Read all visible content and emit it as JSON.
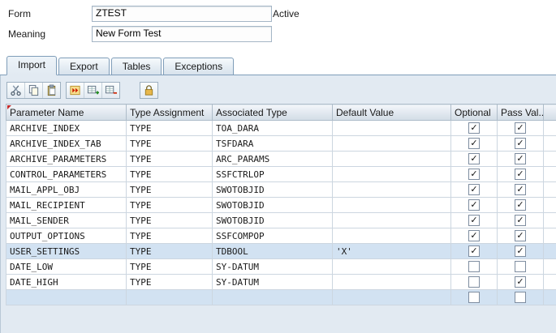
{
  "form_header": {
    "form_label": "Form",
    "form_value": "ZTEST",
    "status": "Active",
    "meaning_label": "Meaning",
    "meaning_value": "New Form Test"
  },
  "tabs": [
    {
      "label": "Import",
      "active": true
    },
    {
      "label": "Export",
      "active": false
    },
    {
      "label": "Tables",
      "active": false
    },
    {
      "label": "Exceptions",
      "active": false
    }
  ],
  "toolbar": {
    "groups": [
      [
        "cut-icon",
        "copy-icon",
        "paste-icon"
      ],
      [
        "double-arrow-icon",
        "insert-row-icon",
        "delete-row-icon"
      ],
      [
        "lock-icon"
      ]
    ]
  },
  "table": {
    "columns": [
      "Parameter Name",
      "Type Assignment",
      "Associated Type",
      "Default Value",
      "Optional",
      "Pass Val..."
    ],
    "rows": [
      {
        "name": "ARCHIVE_INDEX",
        "type": "TYPE",
        "assoc": "TOA_DARA",
        "default": "",
        "optional": true,
        "pass": true,
        "selected": false
      },
      {
        "name": "ARCHIVE_INDEX_TAB",
        "type": "TYPE",
        "assoc": "TSFDARA",
        "default": "",
        "optional": true,
        "pass": true,
        "selected": false
      },
      {
        "name": "ARCHIVE_PARAMETERS",
        "type": "TYPE",
        "assoc": "ARC_PARAMS",
        "default": "",
        "optional": true,
        "pass": true,
        "selected": false
      },
      {
        "name": "CONTROL_PARAMETERS",
        "type": "TYPE",
        "assoc": "SSFCTRLOP",
        "default": "",
        "optional": true,
        "pass": true,
        "selected": false
      },
      {
        "name": "MAIL_APPL_OBJ",
        "type": "TYPE",
        "assoc": "SWOTOBJID",
        "default": "",
        "optional": true,
        "pass": true,
        "selected": false
      },
      {
        "name": "MAIL_RECIPIENT",
        "type": "TYPE",
        "assoc": "SWOTOBJID",
        "default": "",
        "optional": true,
        "pass": true,
        "selected": false
      },
      {
        "name": "MAIL_SENDER",
        "type": "TYPE",
        "assoc": "SWOTOBJID",
        "default": "",
        "optional": true,
        "pass": true,
        "selected": false
      },
      {
        "name": "OUTPUT_OPTIONS",
        "type": "TYPE",
        "assoc": "SSFCOMPOP",
        "default": "",
        "optional": true,
        "pass": true,
        "selected": false
      },
      {
        "name": "USER_SETTINGS",
        "type": "TYPE",
        "assoc": "TDBOOL",
        "default": "'X'",
        "optional": true,
        "pass": true,
        "selected": true
      },
      {
        "name": "DATE_LOW",
        "type": "TYPE",
        "assoc": "SY-DATUM",
        "default": "",
        "optional": false,
        "pass": false,
        "selected": false
      },
      {
        "name": "DATE_HIGH",
        "type": "TYPE",
        "assoc": "SY-DATUM",
        "default": "",
        "optional": false,
        "pass": true,
        "selected": false
      },
      {
        "name": "",
        "type": "",
        "assoc": "",
        "default": "",
        "optional": false,
        "pass": false,
        "selected": true,
        "empty": true
      }
    ]
  }
}
